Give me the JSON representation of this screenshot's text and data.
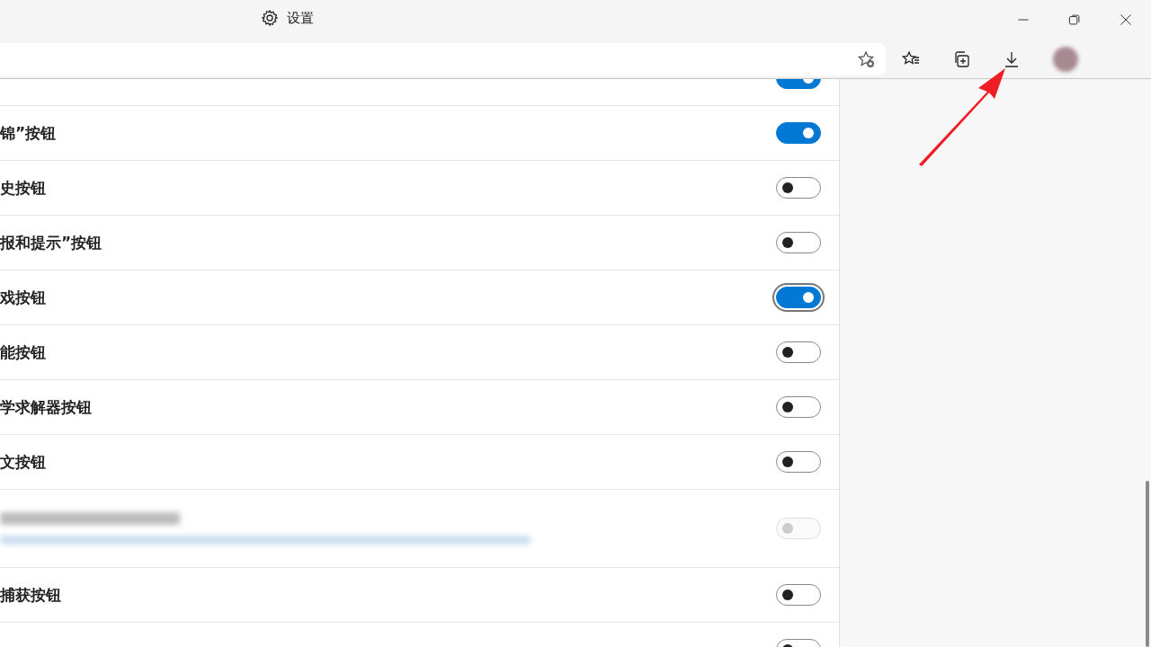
{
  "window": {
    "title": "设置"
  },
  "settings": [
    {
      "kind": "toggle",
      "on": true,
      "focused": false,
      "disabled": false
    },
    {
      "kind": "toggle",
      "label": "锦”按钮",
      "on": true,
      "focused": false,
      "disabled": false
    },
    {
      "kind": "toggle",
      "label": "史按钮",
      "on": false,
      "focused": false,
      "disabled": false
    },
    {
      "kind": "toggle",
      "label": "报和提示”按钮",
      "on": false,
      "focused": false,
      "disabled": false
    },
    {
      "kind": "toggle",
      "label": "戏按钮",
      "on": true,
      "focused": true,
      "disabled": false
    },
    {
      "kind": "toggle",
      "label": "能按钮",
      "on": false,
      "focused": false,
      "disabled": false
    },
    {
      "kind": "toggle",
      "label": "学求解器按钮",
      "on": false,
      "focused": false,
      "disabled": false
    },
    {
      "kind": "toggle",
      "label": "文按钮",
      "on": false,
      "focused": false,
      "disabled": false
    },
    {
      "kind": "redacted",
      "on": false,
      "focused": false,
      "disabled": true
    },
    {
      "kind": "toggle",
      "label": "捕获按钮",
      "on": false,
      "focused": false,
      "disabled": false
    },
    {
      "kind": "toggle",
      "on": false,
      "focused": false,
      "disabled": false
    }
  ]
}
